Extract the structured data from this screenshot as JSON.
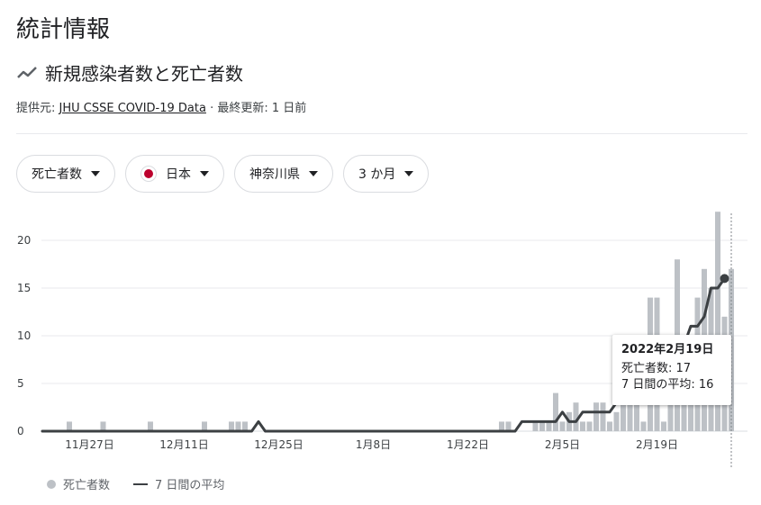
{
  "page": {
    "title": "統計情報"
  },
  "section": {
    "title": "新規感染者数と死亡者数",
    "icon": "trending-icon"
  },
  "source": {
    "prefix": "提供元:",
    "name": "JHU CSSE COVID-19 Data",
    "separator": "·",
    "updated": "最終更新: 1 日前"
  },
  "filters": [
    {
      "label": "死亡者数",
      "icon": "chevron-down-icon"
    },
    {
      "label": "日本",
      "icon": "japan-flag-icon"
    },
    {
      "label": "神奈川県",
      "icon": "chevron-down-icon"
    },
    {
      "label": "3 か月",
      "icon": "chevron-down-icon"
    }
  ],
  "tooltip": {
    "date": "2022年2月19日",
    "deaths": "死亡者数: 17",
    "avg": "7 日間の平均: 16"
  },
  "legend": {
    "bars": "死亡者数",
    "line": "7 日間の平均"
  },
  "colors": {
    "bar": "#bdc1c6",
    "line": "#3c4043",
    "grid": "#e8eaed",
    "flag": "#bc002d"
  },
  "chart_data": {
    "type": "bar",
    "title": "",
    "xlabel": "",
    "ylabel": "",
    "ylim": [
      0,
      22
    ],
    "yticks": [
      0,
      5,
      10,
      15,
      20
    ],
    "xtick_labels": [
      "11月27日",
      "12月11日",
      "12月25日",
      "1月8日",
      "1月22日",
      "2月5日",
      "2月19日"
    ],
    "xtick_days": [
      7,
      21,
      35,
      49,
      63,
      77,
      91
    ],
    "x_start": "2021-11-20",
    "x_end": "2022-02-19",
    "grid": true,
    "legend_position": "bottom-left",
    "series": [
      {
        "name": "死亡者数",
        "type": "bar",
        "values": [
          0,
          0,
          0,
          0,
          1,
          0,
          0,
          0,
          0,
          1,
          0,
          0,
          0,
          0,
          0,
          0,
          1,
          0,
          0,
          0,
          0,
          0,
          0,
          0,
          1,
          0,
          0,
          0,
          1,
          1,
          1,
          0,
          0,
          0,
          0,
          0,
          0,
          0,
          0,
          0,
          0,
          0,
          0,
          0,
          0,
          0,
          0,
          0,
          0,
          0,
          0,
          0,
          0,
          0,
          0,
          0,
          0,
          0,
          0,
          0,
          0,
          0,
          0,
          0,
          0,
          0,
          0,
          0,
          1,
          1,
          0,
          0,
          0,
          1,
          1,
          1,
          4,
          1,
          2,
          3,
          1,
          1,
          3,
          3,
          1,
          2,
          8,
          4,
          5,
          1,
          14,
          14,
          1,
          9,
          18,
          10,
          6,
          14,
          17,
          15,
          23,
          12,
          17
        ]
      },
      {
        "name": "7 日間の平均",
        "type": "line",
        "values": [
          0,
          0,
          0,
          0,
          0,
          0,
          0,
          0,
          0,
          0,
          0,
          0,
          0,
          0,
          0,
          0,
          0,
          0,
          0,
          0,
          0,
          0,
          0,
          0,
          0,
          0,
          0,
          0,
          0,
          0,
          0,
          0,
          1,
          0,
          0,
          0,
          0,
          0,
          0,
          0,
          0,
          0,
          0,
          0,
          0,
          0,
          0,
          0,
          0,
          0,
          0,
          0,
          0,
          0,
          0,
          0,
          0,
          0,
          0,
          0,
          0,
          0,
          0,
          0,
          0,
          0,
          0,
          0,
          0,
          0,
          0,
          1,
          1,
          1,
          1,
          1,
          1,
          2,
          1,
          1,
          2,
          2,
          2,
          2,
          2,
          3,
          3,
          3,
          3,
          3,
          4,
          5,
          5,
          7,
          8,
          9,
          11,
          11,
          12,
          15,
          15,
          16
        ]
      }
    ]
  }
}
